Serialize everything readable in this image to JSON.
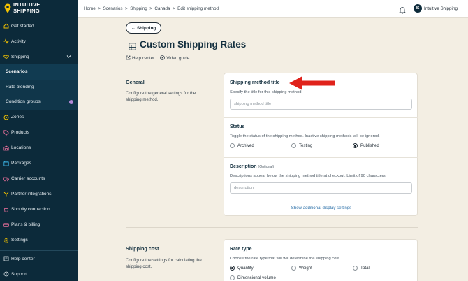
{
  "app": {
    "logo_line1": "INTUITIVE",
    "logo_line2": "SHIPPING"
  },
  "sidebar": {
    "items": [
      {
        "label": "Get started",
        "icon": "home-icon"
      },
      {
        "label": "Activity",
        "icon": "activity-icon"
      },
      {
        "label": "Shipping",
        "icon": "handshake-icon"
      }
    ],
    "subitems": [
      {
        "label": "Scenarios"
      },
      {
        "label": "Rate blending"
      },
      {
        "label": "Condition groups"
      }
    ],
    "items2": [
      {
        "label": "Zones",
        "icon": "zones-icon"
      },
      {
        "label": "Products",
        "icon": "tag-icon"
      },
      {
        "label": "Locations",
        "icon": "warehouse-icon"
      },
      {
        "label": "Packages",
        "icon": "package-icon"
      },
      {
        "label": "Carrier accounts",
        "icon": "truck-icon"
      },
      {
        "label": "Partner integrations",
        "icon": "integration-icon"
      },
      {
        "label": "Shopify connection",
        "icon": "shopify-icon"
      },
      {
        "label": "Plans & billing",
        "icon": "card-icon"
      },
      {
        "label": "Settings",
        "icon": "gear-icon"
      }
    ],
    "bottom": [
      {
        "label": "Help center",
        "icon": "help-icon"
      },
      {
        "label": "Support",
        "icon": "support-icon"
      }
    ],
    "colors": {
      "bg": "#0c2a3a",
      "badge": "#b48ad9"
    }
  },
  "topbar": {
    "breadcrumb": [
      "Home",
      "Scenarios",
      "Shipping",
      "Canada",
      "Edit shipping method"
    ],
    "separator": ">",
    "avatar_initials": "IS",
    "user_name": "Intuitive Shipping"
  },
  "main": {
    "back_label": "← Shipping",
    "title": "Custom Shipping Rates",
    "help_center": "Help center",
    "video_guide": "Video guide",
    "general": {
      "title": "General",
      "desc": "Configure the general settings for the shipping method."
    },
    "method_title": {
      "label": "Shipping method title",
      "help": "Specify the title for this shipping method.",
      "placeholder": "shipping method title"
    },
    "status": {
      "label": "Status",
      "help": "Toggle the status of the shipping method. Inactive shipping methods will be ignored.",
      "options": [
        "Archived",
        "Testing",
        "Published"
      ],
      "selected": "Published"
    },
    "description": {
      "label": "Description",
      "optional": "(Optional)",
      "help": "Descriptions appear below the shipping method title at checkout. Limit of 90 characters.",
      "placeholder": "description"
    },
    "show_more": "Show additional display settings",
    "shipping_cost": {
      "title": "Shipping cost",
      "desc": "Configure the settings for calculating the shipping cost."
    },
    "rate_type": {
      "label": "Rate type",
      "help": "Choose the rate type that will will determine the shipping cost.",
      "options": [
        "Quantity",
        "Weight",
        "Total",
        "Dimensional volume"
      ],
      "selected": "Quantity"
    },
    "colors": {
      "arrow": "#e0221b",
      "link": "#2a6fa8",
      "background": "#f3eee3"
    }
  }
}
